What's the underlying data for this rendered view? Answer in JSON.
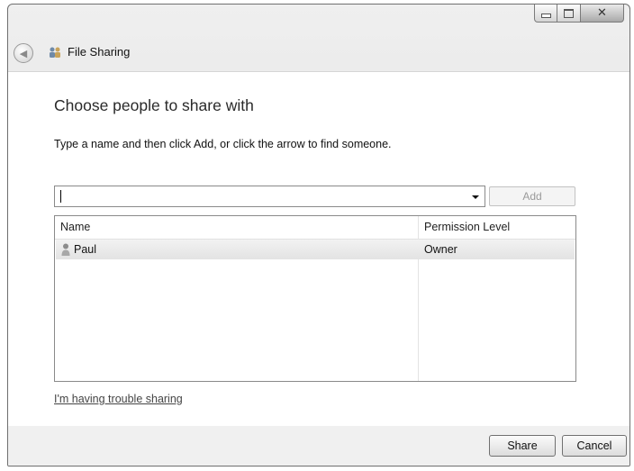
{
  "window": {
    "title": "File Sharing"
  },
  "main": {
    "heading": "Choose people to share with",
    "instructions": "Type a name and then click Add, or click the arrow to find someone.",
    "name_input": {
      "value": "",
      "placeholder": ""
    },
    "add_label": "Add"
  },
  "list": {
    "columns": [
      "Name",
      "Permission Level"
    ],
    "rows": [
      {
        "name": "Paul",
        "permission": "Owner",
        "icon": "user-icon"
      }
    ]
  },
  "help_link": "I'm having trouble sharing",
  "footer": {
    "share_label": "Share",
    "cancel_label": "Cancel"
  },
  "icons": {
    "back": "back-arrow-icon",
    "app": "file-sharing-icon",
    "user": "user-icon"
  },
  "colors": {
    "content_bg": "#ffffff",
    "chrome_bg": "#e4e4e4",
    "selected_row": "#e8e8e8"
  }
}
